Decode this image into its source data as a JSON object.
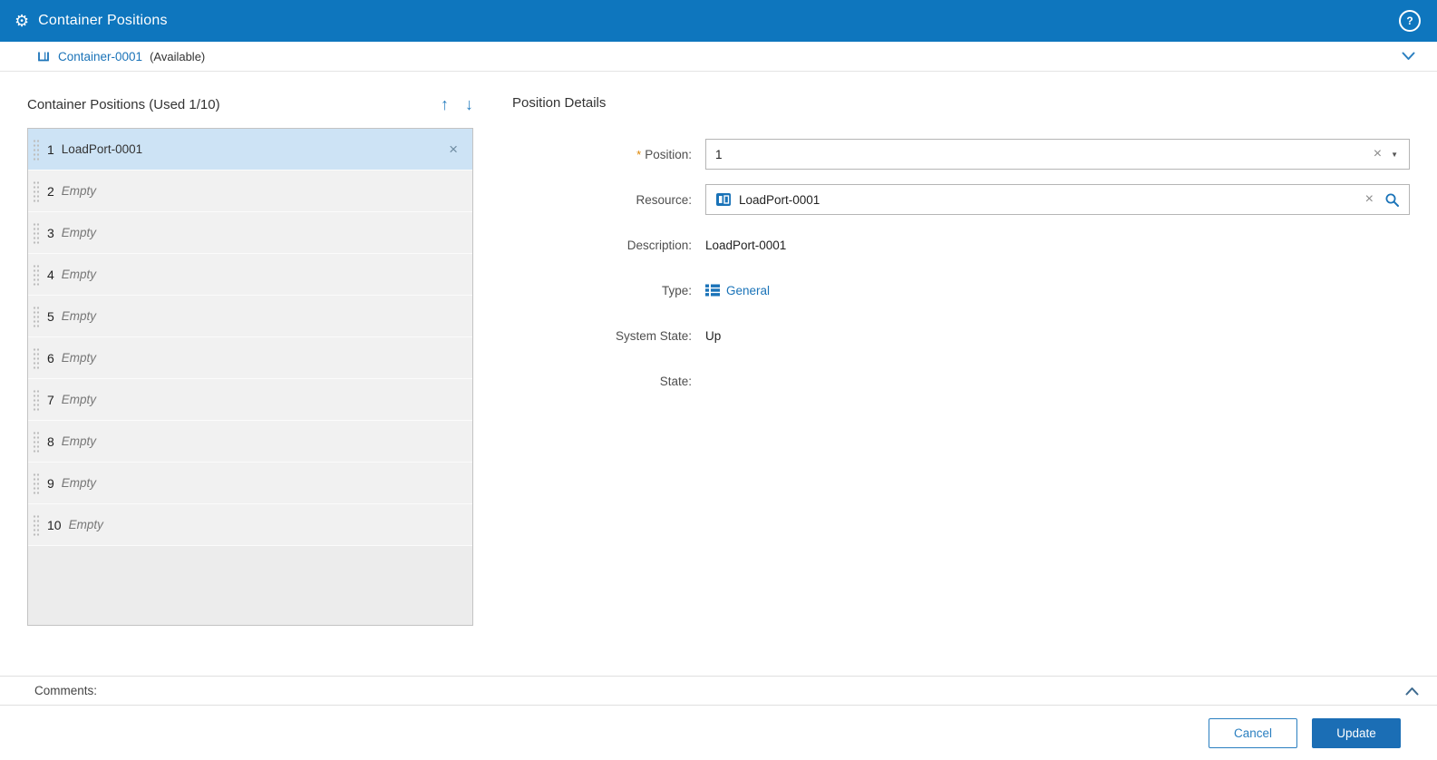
{
  "header": {
    "title": "Container Positions"
  },
  "icons": {
    "gear": "⚙",
    "help": "?",
    "close": "×",
    "caret": "▼",
    "up_arrow": "↑",
    "down_arrow": "↓"
  },
  "breadcrumb": {
    "link": "Container-0001",
    "status": "(Available)"
  },
  "left_panel": {
    "title": "Container Positions (Used 1/10)",
    "rows": [
      {
        "index": "1",
        "label": "LoadPort-0001",
        "selected": true,
        "empty": false
      },
      {
        "index": "2",
        "label": "Empty",
        "selected": false,
        "empty": true
      },
      {
        "index": "3",
        "label": "Empty",
        "selected": false,
        "empty": true
      },
      {
        "index": "4",
        "label": "Empty",
        "selected": false,
        "empty": true
      },
      {
        "index": "5",
        "label": "Empty",
        "selected": false,
        "empty": true
      },
      {
        "index": "6",
        "label": "Empty",
        "selected": false,
        "empty": true
      },
      {
        "index": "7",
        "label": "Empty",
        "selected": false,
        "empty": true
      },
      {
        "index": "8",
        "label": "Empty",
        "selected": false,
        "empty": true
      },
      {
        "index": "9",
        "label": "Empty",
        "selected": false,
        "empty": true
      },
      {
        "index": "10",
        "label": "Empty",
        "selected": false,
        "empty": true
      }
    ]
  },
  "details": {
    "title": "Position Details",
    "fields": {
      "position": {
        "label": "Position:",
        "required": "*",
        "value": "1"
      },
      "resource": {
        "label": "Resource:",
        "value": "LoadPort-0001"
      },
      "description": {
        "label": "Description:",
        "value": "LoadPort-0001"
      },
      "type": {
        "label": "Type:",
        "value": "General"
      },
      "system_state": {
        "label": "System State:",
        "value": "Up"
      },
      "state": {
        "label": "State:",
        "value": ""
      }
    }
  },
  "comments": {
    "label": "Comments:"
  },
  "footer": {
    "cancel_label": "Cancel",
    "update_label": "Update"
  },
  "colors": {
    "header": "#0e76be",
    "accent": "#1a73b8",
    "selected_row": "#cde3f5",
    "update_button": "#1b6eb5",
    "required_asterisk": "#dd8500"
  }
}
